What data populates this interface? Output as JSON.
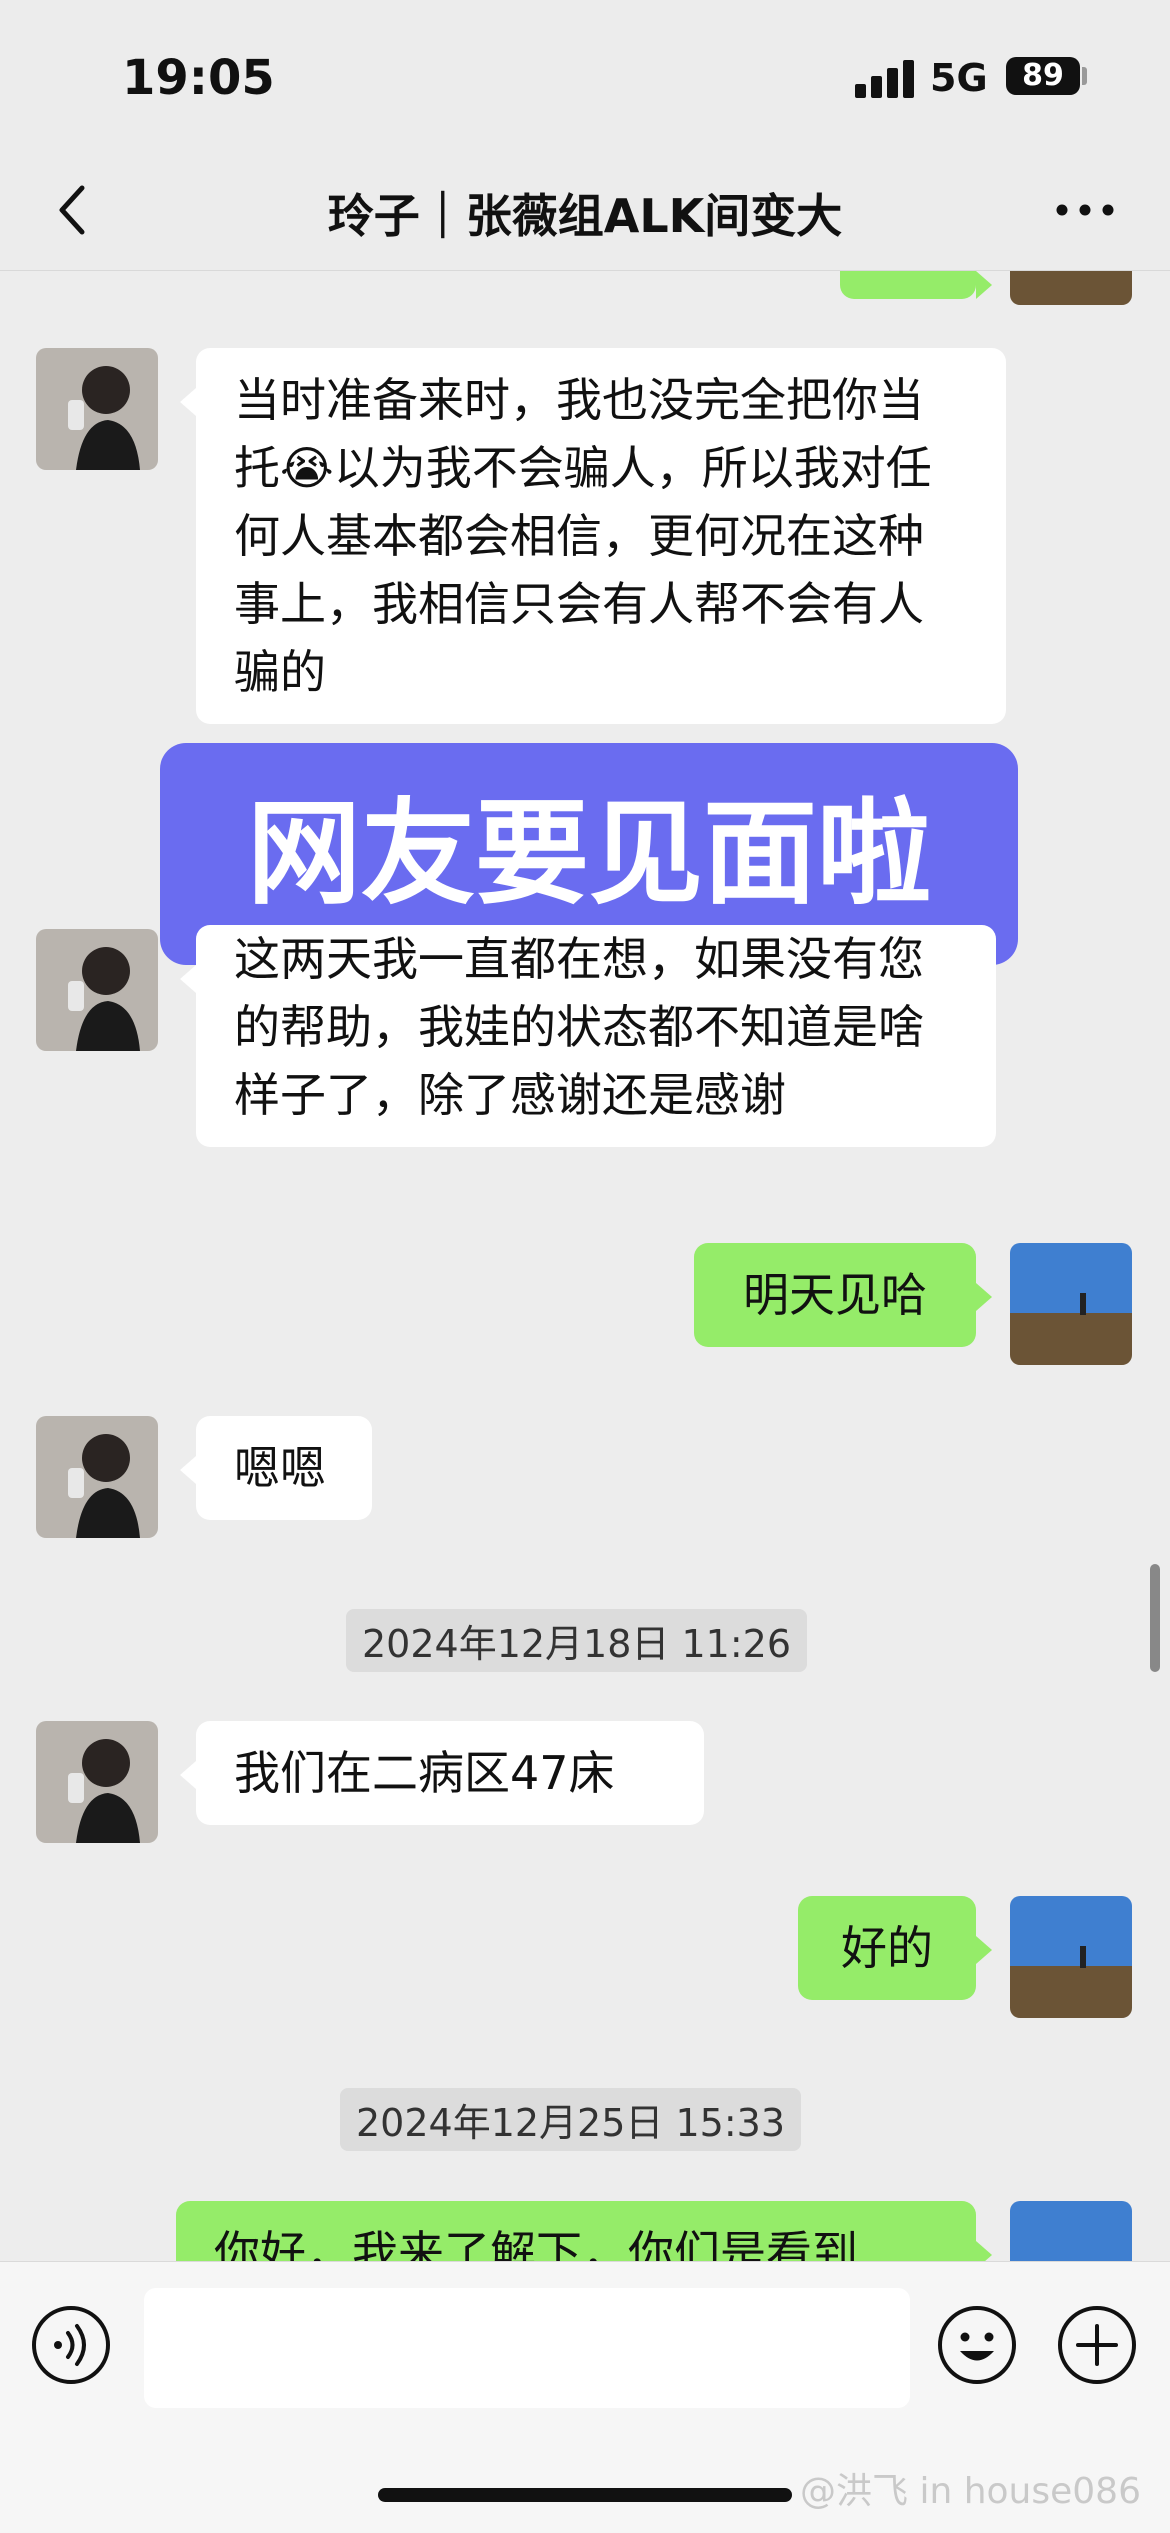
{
  "status_bar": {
    "time": "19:05",
    "network": "5G",
    "battery": "89"
  },
  "header": {
    "title": "玲子｜张薇组ALK间变大"
  },
  "overlay_text": "网友要见面啦",
  "messages": [
    {
      "side": "in",
      "text": "当时准备来时，我也没完全把你当托😭以为我不会骗人，所以我对任何人基本都会相信，更何况在这种事上，我相信只会有人帮不会有人骗的"
    },
    {
      "side": "in",
      "text": "这两天我一直都在想，如果没有您的帮助，我娃的状态都不知道是啥样子了，除了感谢还是感谢"
    },
    {
      "side": "out",
      "text": "明天见哈"
    },
    {
      "side": "in",
      "text": "嗯嗯"
    },
    {
      "side": "time",
      "text": "2024年12月18日 11:26"
    },
    {
      "side": "in",
      "text": "我们在二病区47床"
    },
    {
      "side": "out",
      "text": "好的"
    },
    {
      "side": "time",
      "text": "2024年12月25日 15:33"
    },
    {
      "side": "out",
      "text": "你好，我来了解下，你们是看到"
    }
  ],
  "watermark": "@洪飞 in house086"
}
